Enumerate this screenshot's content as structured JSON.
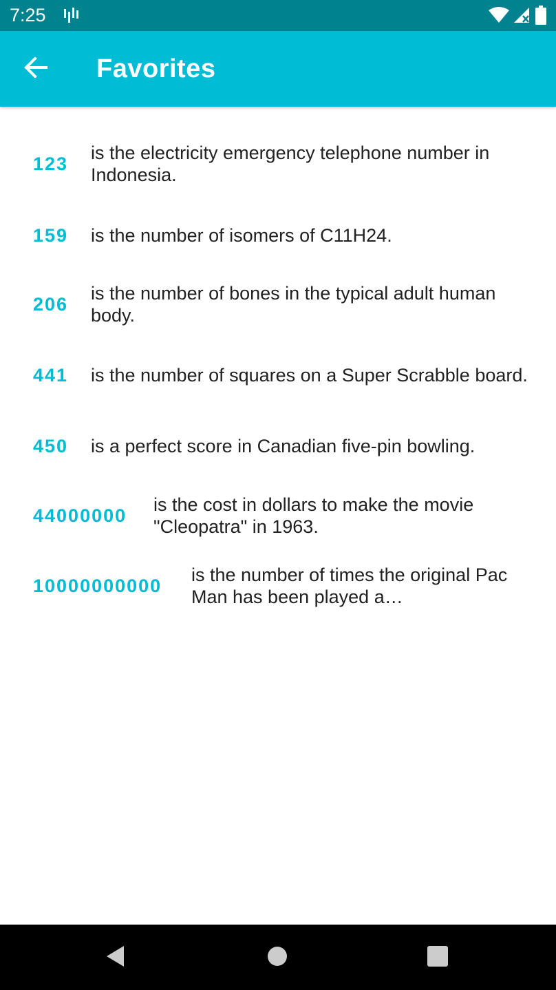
{
  "status_bar": {
    "time": "7:25",
    "icons": [
      "activity-icon",
      "wifi-icon",
      "signal-icon",
      "battery-icon"
    ]
  },
  "app_bar": {
    "title": "Favorites",
    "back_icon": "arrow-back-icon",
    "background": "#00bcd4"
  },
  "favorites": [
    {
      "number": "123",
      "fact": "is the electricity emergency telephone number in Indonesia."
    },
    {
      "number": "159",
      "fact": "is the number of isomers of C11H24."
    },
    {
      "number": "206",
      "fact": "is the number of bones in the typical adult human body."
    },
    {
      "number": "441",
      "fact": "is the number of squares on a Super Scrabble board."
    },
    {
      "number": "450",
      "fact": "is a perfect score in Canadian five-pin bowling."
    },
    {
      "number": "44000000",
      "fact": "is the cost in dollars to make the movie \"Cleopatra\" in 1963."
    },
    {
      "number": "10000000000",
      "fact": "is the number of times the original Pac Man has been played a…"
    }
  ],
  "nav_bar": {
    "buttons": [
      "back-nav-icon",
      "home-nav-icon",
      "recents-nav-icon"
    ]
  },
  "colors": {
    "accent": "#00bcd4",
    "status_bar": "#00838f",
    "text": "#212121"
  }
}
